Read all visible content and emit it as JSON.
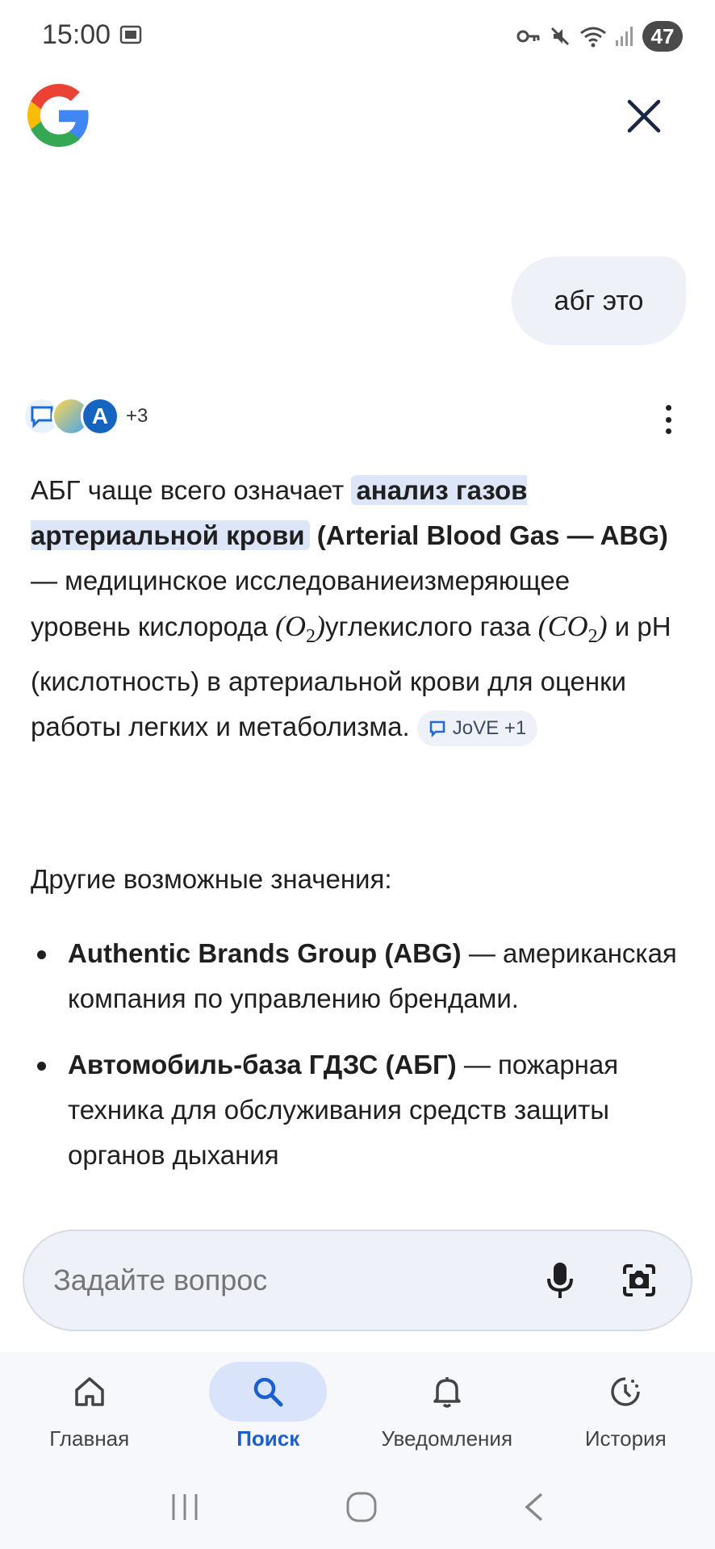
{
  "status_bar": {
    "time": "15:00",
    "battery": "47",
    "icons": [
      "screenshot-icon",
      "vpn-key-icon",
      "mute-icon",
      "wifi-icon",
      "signal-icon"
    ]
  },
  "header": {
    "logo": "google-g-icon",
    "close_icon": "close-icon"
  },
  "query": {
    "text": "абг это"
  },
  "sources": {
    "more_count": "+3"
  },
  "answer": {
    "p1_a": "АБГ чаще всего означает ",
    "p1_highlight": "анализ газов артериальной крови",
    "p1_bold": " (Arterial Blood Gas — ABG)",
    "p1_b": " — медицинское исследованиеизмеряющее уровень кислорода ",
    "o2": "(O",
    "o2_sub": "2",
    "o2_close": ")",
    "p1_c": "углекислого газа ",
    "co2": "(CO",
    "co2_sub": "2",
    "co2_close": ")",
    "p1_d": " и pH (кислотность) в артериальной крови для оценки работы легких и метаболизма.",
    "chip": "JoVE +1"
  },
  "other_meanings": {
    "label": "Другие возможные значения:",
    "items": [
      {
        "bold": "Authentic Brands Group (ABG)",
        "text": " — американская компания по управлению брендами."
      },
      {
        "bold": "Автомобиль-база ГДЗС (АБГ)",
        "text": " — пожарная техника для обслуживания средств защиты органов дыхания"
      }
    ]
  },
  "ask_bar": {
    "placeholder": "Задайте вопрос"
  },
  "bottom_nav": {
    "items": [
      {
        "label": "Главная",
        "icon": "home-icon",
        "active": false
      },
      {
        "label": "Поиск",
        "icon": "search-icon",
        "active": true
      },
      {
        "label": "Уведомления",
        "icon": "bell-icon",
        "active": false
      },
      {
        "label": "История",
        "icon": "history-icon",
        "active": false
      }
    ]
  },
  "colors": {
    "accent": "#1a5fd0",
    "highlight": "#dde6f8",
    "bubble": "#eef1f7"
  }
}
